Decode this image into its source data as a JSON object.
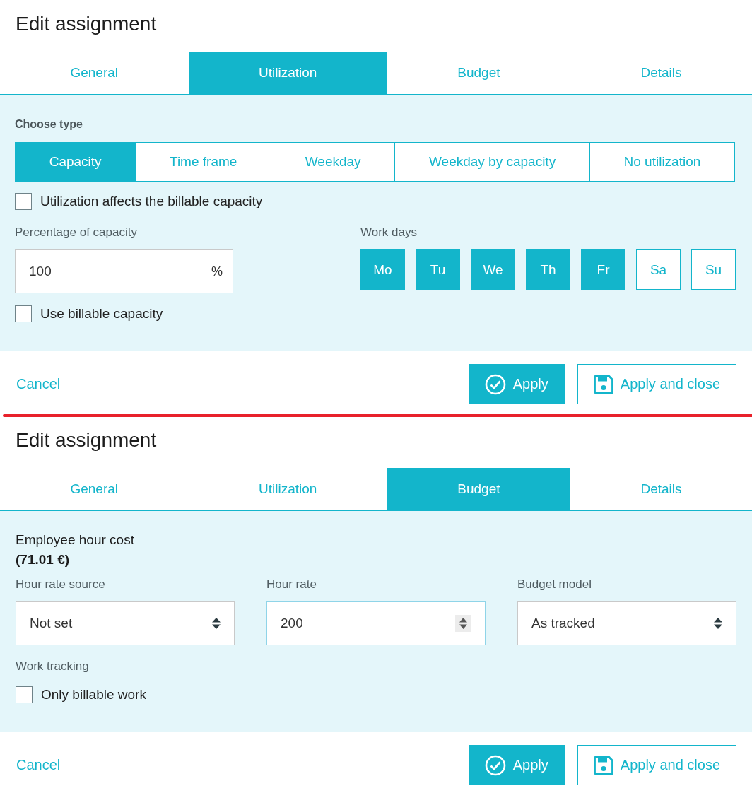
{
  "dialogs": [
    {
      "kind": "utilization",
      "title": "Edit assignment",
      "tabs": [
        {
          "label": "General",
          "selected": false
        },
        {
          "label": "Utilization",
          "selected": true
        },
        {
          "label": "Budget",
          "selected": false
        },
        {
          "label": "Details",
          "selected": false
        }
      ],
      "type_choice": {
        "label": "Choose type",
        "options": [
          {
            "label": "Capacity",
            "selected": true
          },
          {
            "label": "Time frame",
            "selected": false
          },
          {
            "label": "Weekday",
            "selected": false
          },
          {
            "label": "Weekday by capacity",
            "selected": false
          },
          {
            "label": "No utilization",
            "selected": false
          }
        ]
      },
      "affects_billable": {
        "label": "Utilization affects the billable capacity",
        "checked": false
      },
      "percentage": {
        "label": "Percentage of capacity",
        "value": "100",
        "unit": "%"
      },
      "use_billable": {
        "label": "Use billable capacity",
        "checked": false
      },
      "work_days": {
        "label": "Work days",
        "days": [
          {
            "label": "Mo",
            "selected": true
          },
          {
            "label": "Tu",
            "selected": true
          },
          {
            "label": "We",
            "selected": true
          },
          {
            "label": "Th",
            "selected": true
          },
          {
            "label": "Fr",
            "selected": true
          },
          {
            "label": "Sa",
            "selected": false
          },
          {
            "label": "Su",
            "selected": false
          }
        ]
      },
      "footer": {
        "cancel": "Cancel",
        "buttons": [
          {
            "label": "Apply",
            "kind": "primary"
          },
          {
            "label": "Apply and close",
            "kind": "secondary"
          }
        ]
      }
    },
    {
      "kind": "budget",
      "title": "Edit assignment",
      "tabs": [
        {
          "label": "General",
          "selected": false
        },
        {
          "label": "Utilization",
          "selected": false
        },
        {
          "label": "Budget",
          "selected": true
        },
        {
          "label": "Details",
          "selected": false
        }
      ],
      "hour_cost": {
        "label": "Employee hour cost",
        "value": "(71.01 €)"
      },
      "fields": [
        {
          "kind": "select",
          "label": "Hour rate source",
          "value": "Not set",
          "focused": false
        },
        {
          "kind": "number",
          "label": "Hour rate",
          "value": "200",
          "focused": true
        },
        {
          "kind": "select",
          "label": "Budget model",
          "value": "As tracked",
          "focused": false
        }
      ],
      "work_tracking": {
        "label": "Work tracking",
        "option": {
          "label": "Only billable work",
          "checked": false
        }
      },
      "footer": {
        "cancel": "Cancel",
        "buttons": [
          {
            "label": "Apply",
            "kind": "primary"
          },
          {
            "label": "Apply and close",
            "kind": "secondary"
          }
        ]
      }
    }
  ]
}
